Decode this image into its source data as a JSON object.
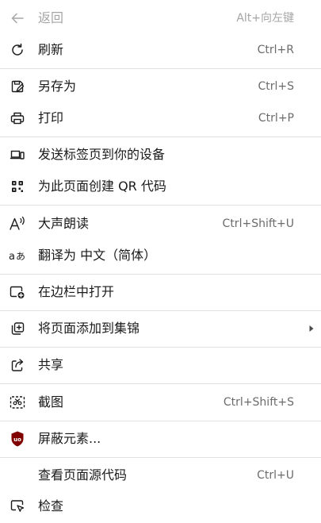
{
  "menu": {
    "items": {
      "back": {
        "label": "返回",
        "shortcut": "Alt+向左键",
        "icon": "back-arrow-icon",
        "enabled": false
      },
      "refresh": {
        "label": "刷新",
        "shortcut": "Ctrl+R",
        "icon": "refresh-icon"
      },
      "save_as": {
        "label": "另存为",
        "shortcut": "Ctrl+S",
        "icon": "save-icon"
      },
      "print": {
        "label": "打印",
        "shortcut": "Ctrl+P",
        "icon": "printer-icon"
      },
      "send_tab": {
        "label": "发送标签页到你的设备",
        "icon": "devices-icon"
      },
      "qr_code": {
        "label": "为此页面创建 QR 代码",
        "icon": "qr-code-icon"
      },
      "read_aloud": {
        "label": "大声朗读",
        "shortcut": "Ctrl+Shift+U",
        "icon": "read-aloud-icon"
      },
      "translate": {
        "label": "翻译为 中文（简体）",
        "icon": "translate-icon"
      },
      "open_sidebar": {
        "label": "在边栏中打开",
        "icon": "sidebar-add-icon"
      },
      "add_collection": {
        "label": "将页面添加到集锦",
        "icon": "collections-icon",
        "has_submenu": true
      },
      "share": {
        "label": "共享",
        "icon": "share-icon"
      },
      "screenshot": {
        "label": "截图",
        "shortcut": "Ctrl+Shift+S",
        "icon": "screenshot-icon"
      },
      "block_element": {
        "label": "屏蔽元素...",
        "icon": "ublock-icon"
      },
      "view_source": {
        "label": "查看页面源代码",
        "shortcut": "Ctrl+U"
      },
      "inspect": {
        "label": "检查",
        "icon": "inspect-icon"
      }
    }
  },
  "colors": {
    "text": "#1a1a1a",
    "shortcut": "#6b6b6b",
    "disabled": "#a6a6a6",
    "separator": "#e1e1e1",
    "ublock_red": "#800000"
  }
}
